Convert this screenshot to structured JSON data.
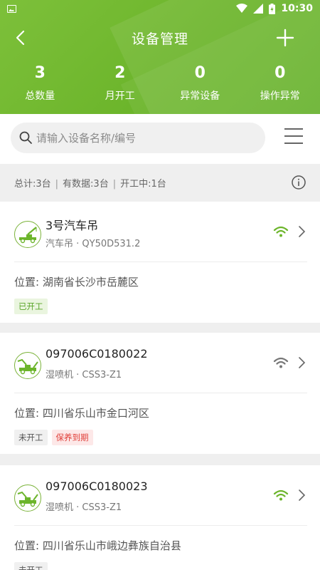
{
  "status_bar": {
    "time": "10:30"
  },
  "header": {
    "title": "设备管理",
    "stats": [
      {
        "value": "3",
        "label": "总数量"
      },
      {
        "value": "2",
        "label": "月开工"
      },
      {
        "value": "0",
        "label": "异常设备"
      },
      {
        "value": "0",
        "label": "操作异常"
      }
    ]
  },
  "search": {
    "placeholder": "请输入设备名称/编号"
  },
  "summary": {
    "total": "总计:3台",
    "has_data": "有数据:3台",
    "running": "开工中:1台",
    "separator": "|"
  },
  "devices": [
    {
      "name": "3号汽车吊",
      "subtitle": "汽车吊 · QY50D531.2",
      "location": "位置: 湖南省长沙市岳麓区",
      "wifi_color": "#6cb52b",
      "tags": [
        {
          "label": "已开工",
          "kind": "on"
        }
      ]
    },
    {
      "name": "097006C0180022",
      "subtitle": "湿喷机 · CSS3-Z1",
      "location": "位置: 四川省乐山市金口河区",
      "wifi_color": "#777777",
      "tags": [
        {
          "label": "未开工",
          "kind": "off"
        },
        {
          "label": "保养到期",
          "kind": "warn"
        }
      ]
    },
    {
      "name": "097006C0180023",
      "subtitle": "湿喷机 · CSS3-Z1",
      "location": "位置: 四川省乐山市峨边彝族自治县",
      "wifi_color": "#6cb52b",
      "tags": [
        {
          "label": "未开工",
          "kind": "off"
        }
      ]
    }
  ],
  "colors": {
    "brand_green": "#6cb52b",
    "warn_red": "#e0403a"
  }
}
